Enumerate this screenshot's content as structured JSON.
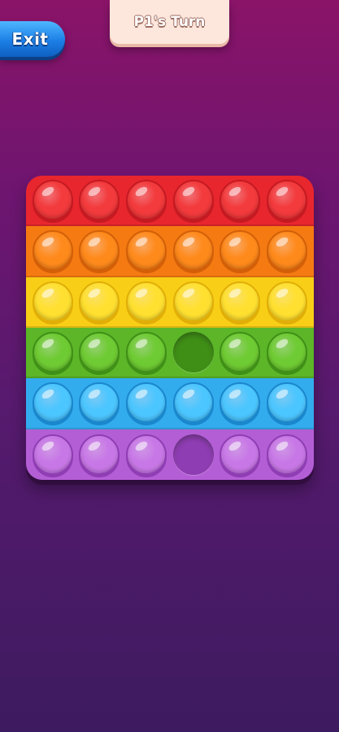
{
  "hud": {
    "exit_label": "Exit",
    "turn_label": "P1's Turn"
  },
  "board": {
    "columns": 6,
    "rows": [
      {
        "color_name": "red",
        "base": "#e8262e",
        "bubble": "#f33a3c",
        "rim": "#c41a22",
        "popped": []
      },
      {
        "color_name": "orange",
        "base": "#f57a12",
        "bubble": "#ff8a1c",
        "rim": "#d25f08",
        "popped": []
      },
      {
        "color_name": "yellow",
        "base": "#f8cf16",
        "bubble": "#ffe030",
        "rim": "#e0ae08",
        "popped": []
      },
      {
        "color_name": "green",
        "base": "#5cb628",
        "bubble": "#6fcb33",
        "rim": "#3f8f17",
        "popped": [
          3
        ]
      },
      {
        "color_name": "blue",
        "base": "#33acee",
        "bubble": "#4cc6ff",
        "rim": "#1a86cc",
        "popped": []
      },
      {
        "color_name": "purple",
        "base": "#b45ed6",
        "bubble": "#c878e6",
        "rim": "#8f3db3",
        "popped": [
          3
        ]
      }
    ]
  }
}
